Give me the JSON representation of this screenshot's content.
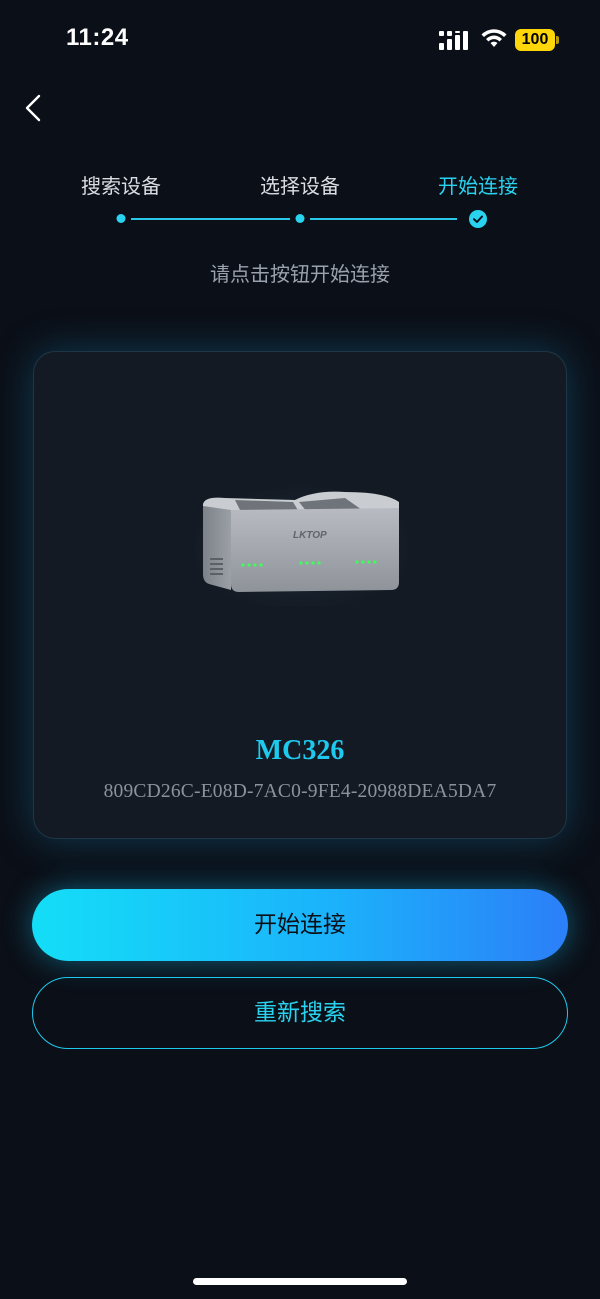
{
  "status_bar": {
    "time": "11:24",
    "battery": "100",
    "battery_color": "#ffd60a"
  },
  "nav": {
    "back_icon": "chevron-left-icon"
  },
  "steps": {
    "items": [
      {
        "label": "搜索设备",
        "active": false
      },
      {
        "label": "选择设备",
        "active": false
      },
      {
        "label": "开始连接",
        "active": true
      }
    ],
    "accent_color": "#29d3f0"
  },
  "hint": "请点击按钮开始连接",
  "device": {
    "image_brand": "LKTOP",
    "name": "MC326",
    "id": "809CD26C-E08D-7AC0-9FE4-20988DEA5DA7"
  },
  "buttons": {
    "connect_label": "开始连接",
    "rescan_label": "重新搜索"
  }
}
